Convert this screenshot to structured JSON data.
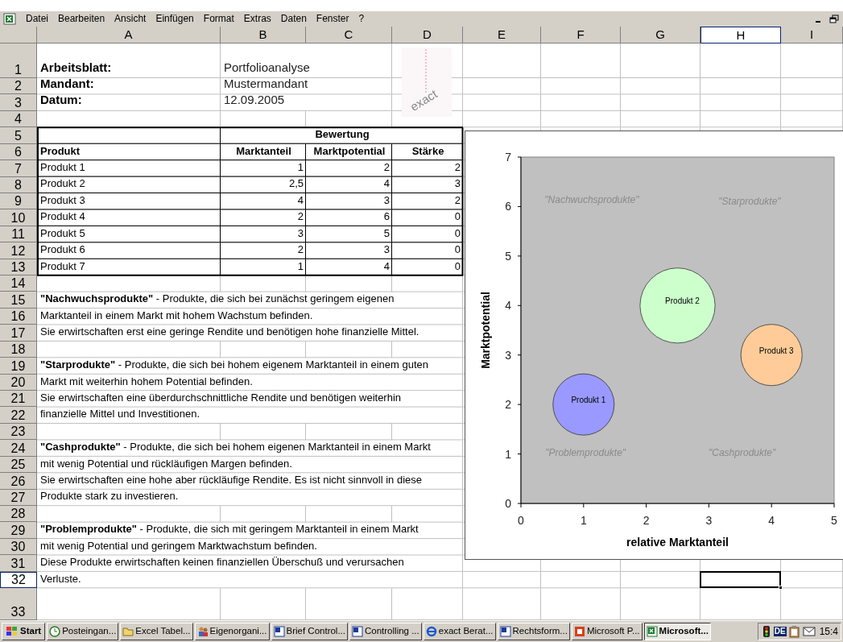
{
  "menu": [
    "Datei",
    "Bearbeiten",
    "Ansicht",
    "Einfügen",
    "Format",
    "Extras",
    "Daten",
    "Fenster",
    "?"
  ],
  "columns": [
    {
      "label": "A",
      "selected": false
    },
    {
      "label": "B",
      "selected": false
    },
    {
      "label": "C",
      "selected": false
    },
    {
      "label": "D",
      "selected": false
    },
    {
      "label": "E",
      "selected": false
    },
    {
      "label": "F",
      "selected": false
    },
    {
      "label": "G",
      "selected": false
    },
    {
      "label": "H",
      "selected": true
    },
    {
      "label": "I",
      "selected": false
    }
  ],
  "row_numbers": [
    {
      "label": "1",
      "selected": false
    },
    {
      "label": "2",
      "selected": false
    },
    {
      "label": "3",
      "selected": false
    },
    {
      "label": "4",
      "selected": false
    },
    {
      "label": "5",
      "selected": false
    },
    {
      "label": "6",
      "selected": false
    },
    {
      "label": "7",
      "selected": false
    },
    {
      "label": "8",
      "selected": false
    },
    {
      "label": "9",
      "selected": false
    },
    {
      "label": "10",
      "selected": false
    },
    {
      "label": "11",
      "selected": false
    },
    {
      "label": "12",
      "selected": false
    },
    {
      "label": "13",
      "selected": false
    },
    {
      "label": "14",
      "selected": false
    },
    {
      "label": "15",
      "selected": false
    },
    {
      "label": "16",
      "selected": false
    },
    {
      "label": "17",
      "selected": false
    },
    {
      "label": "18",
      "selected": false
    },
    {
      "label": "19",
      "selected": false
    },
    {
      "label": "20",
      "selected": false
    },
    {
      "label": "21",
      "selected": false
    },
    {
      "label": "22",
      "selected": false
    },
    {
      "label": "23",
      "selected": false
    },
    {
      "label": "24",
      "selected": false
    },
    {
      "label": "25",
      "selected": false
    },
    {
      "label": "26",
      "selected": false
    },
    {
      "label": "27",
      "selected": false
    },
    {
      "label": "28",
      "selected": false
    },
    {
      "label": "29",
      "selected": false
    },
    {
      "label": "30",
      "selected": false
    },
    {
      "label": "31",
      "selected": false
    },
    {
      "label": "32",
      "selected": true
    },
    {
      "label": "33",
      "selected": false
    }
  ],
  "logo": {
    "text": "exact"
  },
  "info": [
    {
      "label": "Arbeitsblatt:",
      "value": "Portfolioanalyse"
    },
    {
      "label": "Mandant:",
      "value": "Mustermandant"
    },
    {
      "label": "Datum:",
      "value": "12.09.2005"
    }
  ],
  "table": {
    "group": "Bewertung",
    "columns": [
      "Produkt",
      "Marktanteil",
      "Marktpotential",
      "Stärke"
    ],
    "rows": [
      [
        "Produkt 1",
        "1",
        "2",
        "2"
      ],
      [
        "Produkt 2",
        "2,5",
        "4",
        "3"
      ],
      [
        "Produkt 3",
        "4",
        "3",
        "2"
      ],
      [
        "Produkt 4",
        "2",
        "6",
        "0"
      ],
      [
        "Produkt 5",
        "3",
        "5",
        "0"
      ],
      [
        "Produkt 6",
        "2",
        "3",
        "0"
      ],
      [
        "Produkt 7",
        "1",
        "4",
        "0"
      ]
    ]
  },
  "notes": [
    {
      "lines": [
        "**\"Nachwuchsprodukte\"** - Produkte, die sich bei zunächst geringem eigenen",
        "Marktanteil in einem Markt mit hohem Wachstum befinden.",
        "Sie erwirtschaften erst eine geringe Rendite und benötigen hohe finanzielle Mittel."
      ]
    },
    {
      "lines": [
        "**\"Starprodukte\"** - Produkte, die sich bei hohem eigenem Marktanteil in einem guten",
        "Markt mit weiterhin hohem Potential befinden.",
        "Sie erwirtschaften eine überdurchschnittliche Rendite und benötigen weiterhin",
        "finanzielle Mittel und Investitionen."
      ]
    },
    {
      "lines": [
        "**\"Cashprodukte\"** - Produkte, die sich bei hohem eigenen Marktanteil in einem Markt",
        "mit wenig Potential und rückläufigen Margen befinden.",
        "Sie erwirtschaften eine hohe aber rückläufige Rendite. Es ist nicht sinnvoll in diese",
        "Produkte stark zu investieren."
      ]
    },
    {
      "lines": [
        "**\"Problemprodukte\"** - Produkte, die sich mit geringem Marktanteil in einem Markt",
        "mit wenig Potential und geringem Marktwachstum befinden.",
        "Diese Produkte erwirtschaften keinen finanziellen Überschuß und verursachen",
        "Verluste."
      ]
    }
  ],
  "chart_data": {
    "type": "scatter",
    "xlabel": "relative Marktanteil",
    "ylabel": "Marktpotential",
    "xlim": [
      0,
      5
    ],
    "ylim": [
      0,
      7
    ],
    "xticks": [
      0,
      1,
      2,
      3,
      4,
      5
    ],
    "yticks": [
      0,
      1,
      2,
      3,
      4,
      5,
      6,
      7
    ],
    "series": [
      {
        "name": "Produkt 1",
        "color": "#9999ff",
        "x": [
          1
        ],
        "values": [
          2
        ]
      },
      {
        "name": "Produkt 2",
        "color": "#ccffcc",
        "x": [
          2.5
        ],
        "values": [
          4
        ]
      },
      {
        "name": "Produkt 3",
        "color": "#ffcc99",
        "x": [
          4
        ],
        "values": [
          3
        ]
      }
    ],
    "annotations": [
      "\"Nachwuchsprodukte\"",
      "\"Starprodukte\"",
      "\"Problemprodukte\"",
      "\"Cashprodukte\""
    ]
  },
  "taskbar": {
    "start": "Start",
    "items": [
      {
        "label": "Posteingan...",
        "kind": "mail",
        "selected": false
      },
      {
        "label": "Excel Tabel...",
        "kind": "folder",
        "selected": false
      },
      {
        "label": "Eigenorgani...",
        "kind": "people",
        "selected": false
      },
      {
        "label": "Brief Control...",
        "kind": "document",
        "selected": false
      },
      {
        "label": "Controlling ...",
        "kind": "document",
        "selected": false
      },
      {
        "label": "exact Berat...",
        "kind": "browser",
        "selected": false
      },
      {
        "label": "Rechtsform...",
        "kind": "document",
        "selected": false
      },
      {
        "label": "Microsoft P...",
        "kind": "presentation",
        "selected": false
      },
      {
        "label": "Microsoft...",
        "kind": "spreadsheet",
        "selected": true
      }
    ],
    "tray": {
      "language": "DE",
      "clock": "15:4"
    }
  }
}
